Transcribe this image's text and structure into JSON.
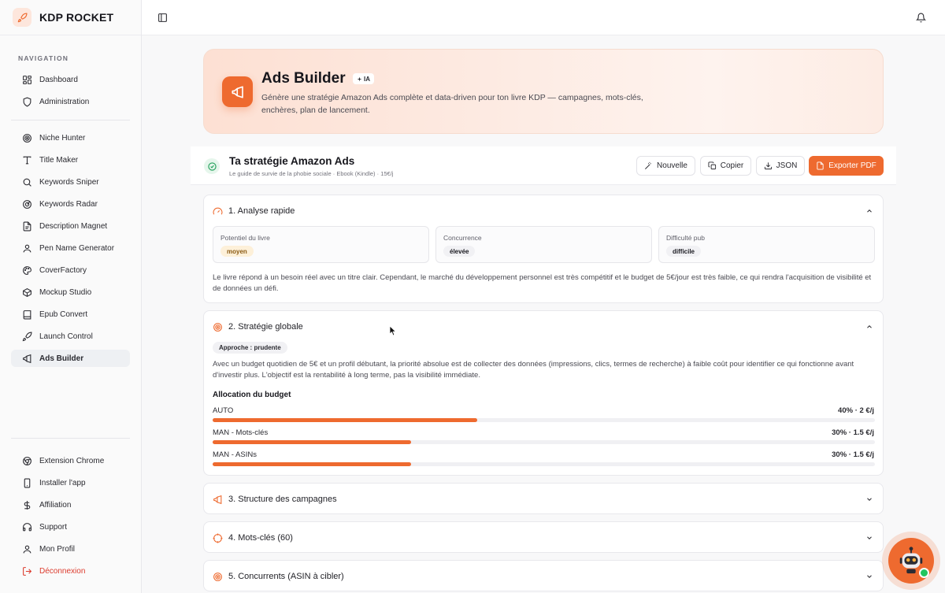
{
  "brand": {
    "name": "KDP ROCKET",
    "icon": "rocket-icon"
  },
  "sidebar": {
    "heading": "NAVIGATION",
    "group1": [
      {
        "label": "Dashboard",
        "icon": "dashboard-icon"
      },
      {
        "label": "Administration",
        "icon": "shield-icon"
      }
    ],
    "group2": [
      {
        "label": "Niche Hunter",
        "icon": "target-icon"
      },
      {
        "label": "Title Maker",
        "icon": "text-icon"
      },
      {
        "label": "Keywords Sniper",
        "icon": "search-icon"
      },
      {
        "label": "Keywords Radar",
        "icon": "radar-icon"
      },
      {
        "label": "Description Magnet",
        "icon": "file-icon"
      },
      {
        "label": "Pen Name Generator",
        "icon": "user-icon"
      },
      {
        "label": "CoverFactory",
        "icon": "palette-icon"
      },
      {
        "label": "Mockup Studio",
        "icon": "box-icon"
      },
      {
        "label": "Epub Convert",
        "icon": "book-icon"
      },
      {
        "label": "Launch Control",
        "icon": "rocket-icon"
      },
      {
        "label": "Ads Builder",
        "icon": "megaphone-icon",
        "active": true
      }
    ],
    "bottom": [
      {
        "label": "Extension Chrome",
        "icon": "chrome-icon"
      },
      {
        "label": "Installer l'app",
        "icon": "phone-icon"
      },
      {
        "label": "Affiliation",
        "icon": "dollar-icon"
      },
      {
        "label": "Support",
        "icon": "headset-icon"
      },
      {
        "label": "Mon Profil",
        "icon": "user-icon"
      },
      {
        "label": "Déconnexion",
        "icon": "logout-icon"
      }
    ]
  },
  "hero": {
    "title": "Ads Builder",
    "badge": "IA",
    "description": "Génère une stratégie Amazon Ads complète et data-driven pour ton livre KDP — campagnes, mots-clés, enchères, plan de lancement."
  },
  "strategy": {
    "title": "Ta stratégie Amazon Ads",
    "subtitle": "Le guide de survie de la phobie sociale · Ebook (Kindle) · 15€/j",
    "buttons": {
      "new": "Nouvelle",
      "copy": "Copier",
      "json": "JSON",
      "export": "Exporter PDF"
    }
  },
  "analysis": {
    "title": "1. Analyse rapide",
    "stats": [
      {
        "label": "Potentiel du livre",
        "value": "moyen"
      },
      {
        "label": "Concurrence",
        "value": "élevée"
      },
      {
        "label": "Difficulté pub",
        "value": "difficile"
      }
    ],
    "text": "Le livre répond à un besoin réel avec un titre clair. Cependant, le marché du développement personnel est très compétitif et le budget de 5€/jour est très faible, ce qui rendra l'acquisition de visibilité et de données un défi."
  },
  "global": {
    "title": "2. Stratégie globale",
    "approach": "Approche : prudente",
    "text": "Avec un budget quotidien de 5€ et un profil débutant, la priorité absolue est de collecter des données (impressions, clics, termes de recherche) à faible coût pour identifier ce qui fonctionne avant d'investir plus. L'objectif est la rentabilité à long terme, pas la visibilité immédiate.",
    "allocation_title": "Allocation du budget",
    "allocation": [
      {
        "label": "AUTO",
        "display": "40% · 2 €/j",
        "percent": 40
      },
      {
        "label": "MAN - Mots-clés",
        "display": "30% · 1.5 €/j",
        "percent": 30
      },
      {
        "label": "MAN - ASINs",
        "display": "30% · 1.5 €/j",
        "percent": 30
      }
    ]
  },
  "sections": {
    "campaigns": "3. Structure des campagnes",
    "keywords": "4. Mots-clés (60)",
    "competitors": "5. Concurrents (ASIN à cibler)"
  },
  "colors": {
    "accent": "#ee6a2f",
    "danger": "#dc3a2c",
    "success": "#22c55e"
  }
}
